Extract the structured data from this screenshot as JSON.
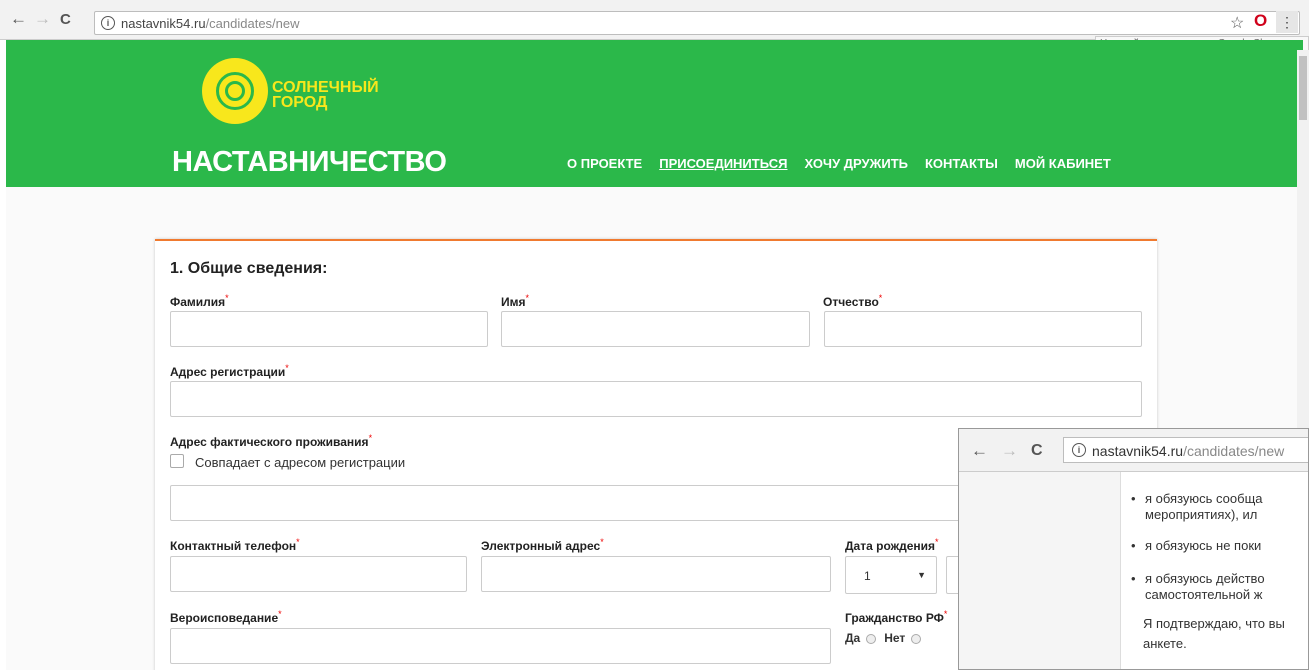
{
  "browser": {
    "url_host": "nastavnik54.ru",
    "url_path": "/candidates/new",
    "tooltip": "Настройка и управление Google Chrome",
    "back_icon": "←",
    "forward_icon": "→",
    "reload_icon": "C",
    "star_icon": "☆",
    "opera_icon": "O",
    "menu_icon": "⋮"
  },
  "header": {
    "logo_line1": "СОЛНЕЧНЫЙ",
    "logo_line2": "ГОРОД",
    "brand": "НАСТАВНИЧЕСТВО",
    "nav": [
      "О ПРОЕКТЕ",
      "ПРИСОЕДИНИТЬСЯ",
      "ХОЧУ ДРУЖИТЬ",
      "КОНТАКТЫ",
      "МОЙ КАБИНЕТ"
    ],
    "active_nav": "ПРИСОЕДИНИТЬСЯ",
    "brand_color": "#2bb84a",
    "accent_color": "#f07a2f"
  },
  "form": {
    "section_title": "1. Общие сведения:",
    "required_mark": "*",
    "labels": {
      "last_name": "Фамилия",
      "first_name": "Имя",
      "patronymic": "Отчество",
      "reg_address": "Адрес регистрации",
      "actual_address": "Адрес фактического проживания",
      "same_address": "Совпадает с адресом регистрации",
      "phone": "Контактный телефон",
      "email": "Электронный адрес",
      "birth_date": "Дата рождения",
      "religion": "Вероисповедание",
      "citizenship": "Гражданство РФ",
      "yes": "Да",
      "no": "Нет"
    },
    "birth_day_value": "1"
  },
  "overlay": {
    "url_host": "nastavnik54.ru",
    "url_path": "/candidates/new",
    "bullet": "•",
    "lines": [
      "я обязуюсь сообща",
      "мероприятиях), ил",
      "я обязуюсь не поки",
      "я обязуюсь действо",
      "самостоятельной ж",
      "Я подтверждаю, что вы",
      "анкете."
    ]
  }
}
